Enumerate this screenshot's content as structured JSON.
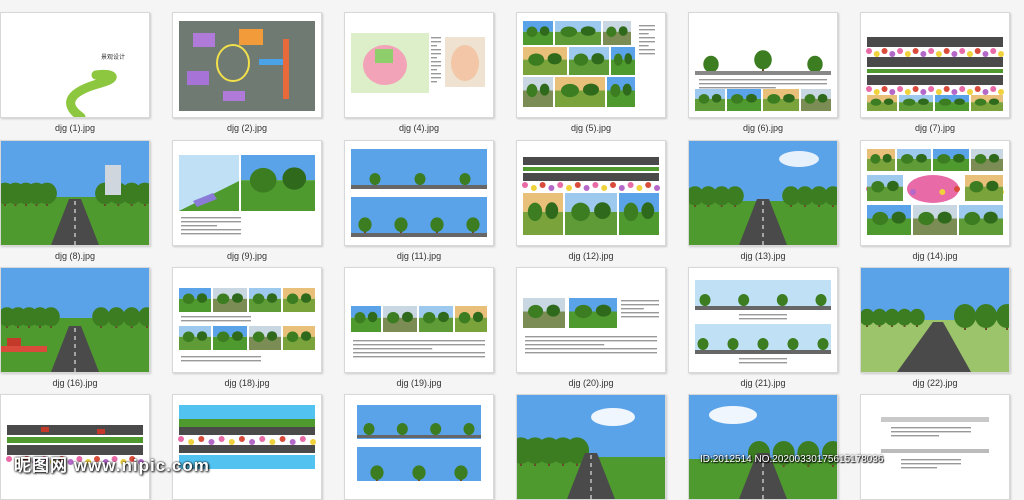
{
  "files": [
    {
      "name": "djg (1).jpg",
      "kind": "cover",
      "title": "景观设计"
    },
    {
      "name": "djg (2).jpg",
      "kind": "aerial"
    },
    {
      "name": "djg (4).jpg",
      "kind": "plan"
    },
    {
      "name": "djg (5).jpg",
      "kind": "collage"
    },
    {
      "name": "djg (6).jpg",
      "kind": "section-trees"
    },
    {
      "name": "djg (7).jpg",
      "kind": "road-strips"
    },
    {
      "name": "djg (8).jpg",
      "kind": "road-render"
    },
    {
      "name": "djg (9).jpg",
      "kind": "render-pair"
    },
    {
      "name": "djg (11).jpg",
      "kind": "sections-pair"
    },
    {
      "name": "djg (12).jpg",
      "kind": "strip-photos"
    },
    {
      "name": "djg (13).jpg",
      "kind": "road-sky"
    },
    {
      "name": "djg (14).jpg",
      "kind": "flower-collage"
    },
    {
      "name": "djg (16).jpg",
      "kind": "road-render-red"
    },
    {
      "name": "djg (18).jpg",
      "kind": "photo-rows"
    },
    {
      "name": "djg (19).jpg",
      "kind": "road-photos-text"
    },
    {
      "name": "djg (20).jpg",
      "kind": "photos-text"
    },
    {
      "name": "djg (21).jpg",
      "kind": "sections-pair-b"
    },
    {
      "name": "djg (22).jpg",
      "kind": "road-empty"
    },
    {
      "name": "",
      "kind": "strip-cars"
    },
    {
      "name": "",
      "kind": "strip-water"
    },
    {
      "name": "",
      "kind": "section-sky"
    },
    {
      "name": "",
      "kind": "road-sky2"
    },
    {
      "name": "",
      "kind": "road-sky3"
    },
    {
      "name": "",
      "kind": "section-line"
    }
  ],
  "watermark": {
    "site": "昵图网 www.nipic.com",
    "id_line": "ID:2012514 NO:20200330175615178036"
  },
  "colors": {
    "sky": "#5aa3e8",
    "grass": "#4e9a2e",
    "tree": "#3c7d22",
    "road": "#4a4a4a",
    "flower_pink": "#e86aa6",
    "flower_yellow": "#f0d23c",
    "cover_green": "#8dc63f"
  }
}
